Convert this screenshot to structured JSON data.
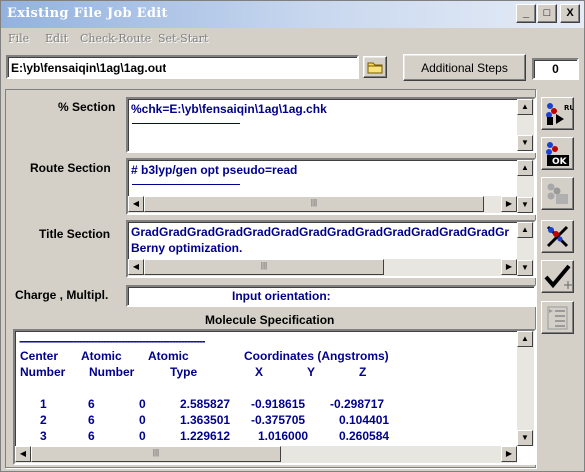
{
  "window": {
    "title": "Existing File Job Edit",
    "controls": {
      "minimize": "_",
      "maximize": "□",
      "close": "X"
    }
  },
  "menu": [
    "File",
    "Edit",
    "Check-Route",
    "Set-Start"
  ],
  "file_path": "E:\\yb\\fensaiqin\\1ag\\1ag.out",
  "additional_steps_label": "Additional Steps",
  "steps_count": "0",
  "percent_section": {
    "label": "% Section",
    "text": "%chk=E:\\yb\\fensaiqin\\1ag\\1ag.chk"
  },
  "route_section": {
    "label": "Route Section",
    "text": "# b3lyp/gen opt pseudo=read"
  },
  "title_section": {
    "label": "Title Section",
    "line1": "GradGradGradGradGradGradGradGradGradGradGradGradGradGr",
    "line2": "Berny optimization."
  },
  "charge": {
    "label": "Charge , Multipl.",
    "text": "Input orientation:"
  },
  "molecule": {
    "heading": "Molecule Specification",
    "separator": "--------------------------------------------------------------",
    "header1": {
      "c1": "Center",
      "c2": "Atomic",
      "c3": "Atomic",
      "c4": "Coordinates (Angstroms)"
    },
    "header2": {
      "c1": "Number",
      "c2": "Number",
      "c3": "Type",
      "x": "X",
      "y": "Y",
      "z": "Z"
    },
    "rows": [
      {
        "center": "1",
        "atomic_number": "6",
        "type": "0",
        "x": "2.585827",
        "y": "-0.918615",
        "z": "-0.298717"
      },
      {
        "center": "2",
        "atomic_number": "6",
        "type": "0",
        "x": "1.363501",
        "y": "-0.375705",
        "z": "0.104401"
      },
      {
        "center": "3",
        "atomic_number": "6",
        "type": "0",
        "x": "1.229612",
        "y": "1.016000",
        "z": "0.260584"
      }
    ]
  },
  "side_buttons": [
    {
      "icon": "run-icon",
      "text": "RUN"
    },
    {
      "icon": "ok-icon",
      "text": "OK"
    },
    {
      "icon": "molecule-icon",
      "text": ""
    },
    {
      "icon": "cancel-icon",
      "text": ""
    },
    {
      "icon": "check-icon",
      "text": ""
    },
    {
      "icon": "list-icon",
      "text": ""
    }
  ],
  "colors": {
    "title_gradient_start": "#93b2de",
    "text_blue": "#00008b",
    "face": "#d4d0c8"
  }
}
